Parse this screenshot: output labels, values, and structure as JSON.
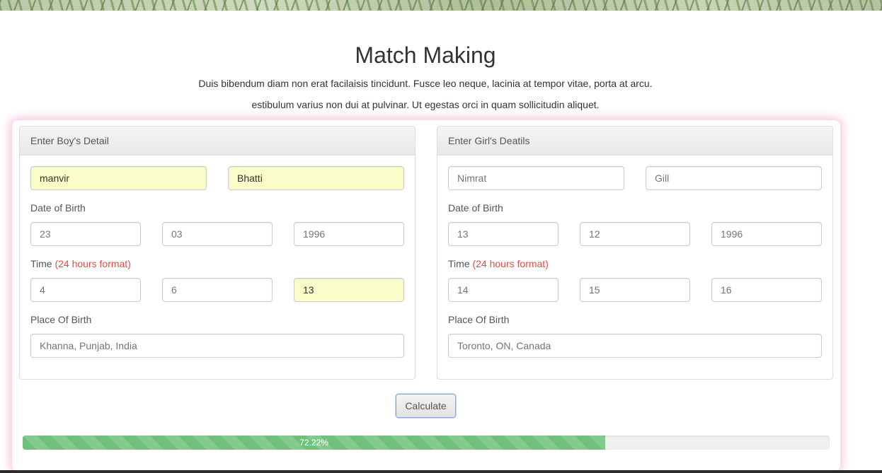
{
  "header": {
    "title": "Match Making",
    "desc_line1": "Duis bibendum diam non erat facilaisis tincidunt. Fusce leo neque, lacinia at tempor vitae, porta at arcu.",
    "desc_line2": "estibulum varius non dui at pulvinar. Ut egestas orci in quam sollicitudin aliquet."
  },
  "boy": {
    "heading": "Enter Boy's Detail",
    "first_name": "manvir",
    "last_name": "Bhatti",
    "dob_label": "Date of Birth",
    "dob_day": "23",
    "dob_month": "03",
    "dob_year": "1996",
    "time_label": "Time",
    "time_hint": "(24 hours format)",
    "time_hour": "4",
    "time_min": "6",
    "time_sec": "13",
    "place_label": "Place Of Birth",
    "place": "Khanna, Punjab, India"
  },
  "girl": {
    "heading": "Enter Girl's Deatils",
    "first_name": "Nimrat",
    "last_name": "Gill",
    "dob_label": "Date of Birth",
    "dob_day": "13",
    "dob_month": "12",
    "dob_year": "1996",
    "time_label": "Time",
    "time_hint": "(24 hours format)",
    "time_hour": "14",
    "time_min": "15",
    "time_sec": "16",
    "place_label": "Place Of Birth",
    "place": "Toronto, ON, Canada"
  },
  "calculate_label": "Calculate",
  "progress": {
    "value_percent": 72.22,
    "label": "72.22%",
    "color": "#6fc07a"
  },
  "colors": {
    "autofill_bg": "#fafdca",
    "hint_red": "#e84a4a",
    "card_glow": "#eca0c8"
  }
}
